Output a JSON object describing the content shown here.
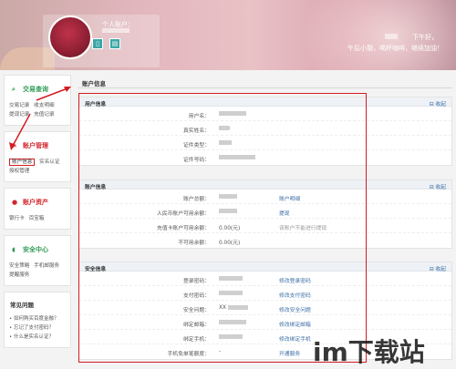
{
  "header": {
    "account_label": "个人账户：",
    "greeting_line1": "下午好，",
    "greeting_line2": "午后小憩，喝杯咖啡，继续加油！"
  },
  "sidebar": {
    "groups": [
      {
        "title": "交易查询",
        "icon": "search-icon",
        "color": "#2f9b55",
        "links": [
          "交易记录",
          "收支明细",
          "提现记录",
          "充值记录"
        ]
      },
      {
        "title": "账户管理",
        "icon": "edit-icon",
        "color": "#d3262c",
        "links": [
          "账户信息",
          "实名认证",
          "授权管理"
        ]
      },
      {
        "title": "账户资产",
        "icon": "asset-icon",
        "color": "#d3262c",
        "links": [
          "银行卡",
          "百宝箱"
        ]
      },
      {
        "title": "安全中心",
        "icon": "shield-icon",
        "color": "#2f9b55",
        "links": [
          "安全策略",
          "手机邮服务",
          "提醒服务"
        ]
      }
    ],
    "faq": {
      "title": "常见问题",
      "items": [
        "• 如何购买百度金融？",
        "• 忘记了支付密码？",
        "• 什么是实名认证？"
      ]
    }
  },
  "main": {
    "title": "账户信息",
    "collapse_label": "收起",
    "user_info": {
      "title": "用户信息",
      "rows": [
        {
          "label": "用户名："
        },
        {
          "label": "真实姓名："
        },
        {
          "label": "证件类型："
        },
        {
          "label": "证件号码："
        }
      ]
    },
    "account_info": {
      "title": "账户信息",
      "rows": [
        {
          "label": "账户总额：",
          "value": "",
          "action": "账户明细"
        },
        {
          "label": "人民币账户可用余额：",
          "value": "",
          "action": "提现"
        },
        {
          "label": "充值卡账户可用余额：",
          "value": "0.00(元)",
          "action": "该账户不能进行提现"
        },
        {
          "label": "不可用余额：",
          "value": "0.00(元)",
          "action": ""
        }
      ]
    },
    "security_info": {
      "title": "安全信息",
      "rows": [
        {
          "label": "登录密码：",
          "value": "",
          "action": "修改登录密码"
        },
        {
          "label": "支付密码：",
          "value": "",
          "action": "修改支付密码"
        },
        {
          "label": "安全问题：",
          "value": "XX",
          "action": "修改安全问题"
        },
        {
          "label": "绑定邮箱：",
          "value": "",
          "action": "修改绑定邮箱"
        },
        {
          "label": "绑定手机：",
          "value": "",
          "action": "修改绑定手机"
        },
        {
          "label": "手机免单笔额度：",
          "value": "-",
          "action": "开通服务"
        }
      ]
    }
  },
  "watermark": "im下载站"
}
